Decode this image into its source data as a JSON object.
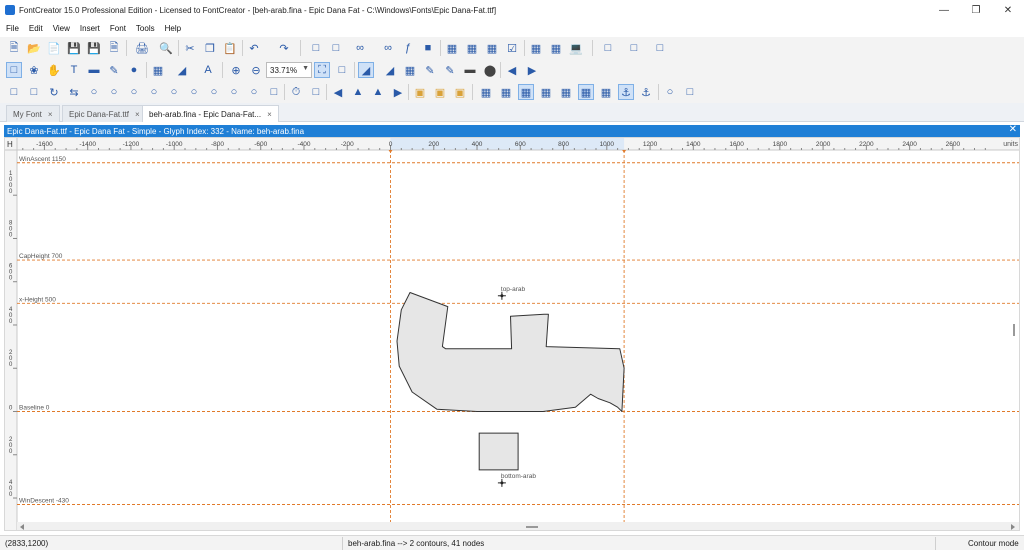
{
  "window": {
    "title": "FontCreator 15.0 Professional Edition - Licensed to FontCreator - [beh-arab.fina - Epic Dana Fat - C:\\Windows\\Fonts\\Epic Dana-Fat.ttf]",
    "minimize": "—",
    "maximize": "❐",
    "close": "✕"
  },
  "menu": [
    "File",
    "Edit",
    "View",
    "Insert",
    "Font",
    "Tools",
    "Help"
  ],
  "toolbar": {
    "zoom": "33.71%"
  },
  "tabs": [
    {
      "label": "My Font",
      "close": "×"
    },
    {
      "label": "Epic Dana-Fat.ttf",
      "close": "×"
    },
    {
      "label": "beh-arab.fina - Epic Dana-Fat...",
      "close": "×"
    }
  ],
  "document": {
    "title": "Epic Dana-Fat.ttf - Epic Dana Fat - Simple - Glyph Index: 332 - Name: beh-arab.fina",
    "close": "✕"
  },
  "ruler": {
    "corner": "H",
    "units": "units",
    "x_ticks": [
      -1600,
      -1400,
      -1200,
      -1000,
      -800,
      -600,
      -400,
      -200,
      0,
      200,
      400,
      600,
      800,
      1000,
      1200,
      1400,
      1600,
      1800,
      2000,
      2200,
      2400,
      2600
    ],
    "y_labels": [
      {
        "text": "1000",
        "value": 1000
      },
      {
        "text": "800",
        "value": 800
      },
      {
        "text": "600",
        "value": 600
      },
      {
        "text": "400",
        "value": 400
      },
      {
        "text": "200",
        "value": 200
      },
      {
        "text": "0",
        "value": 0
      },
      {
        "text": "200",
        "value": -200
      },
      {
        "text": "400",
        "value": -400
      }
    ]
  },
  "guidelines": [
    {
      "label": "WinAscent 1150",
      "value": 1150
    },
    {
      "label": "CapHeight 700",
      "value": 700
    },
    {
      "label": "x-Height 500",
      "value": 500
    },
    {
      "label": "Baseline 0",
      "value": 0
    },
    {
      "label": "WinDescent -430",
      "value": -430
    }
  ],
  "vertical_guides": [
    0,
    1080
  ],
  "anchors": [
    {
      "label": "top-arab",
      "x": 515,
      "y": 535
    },
    {
      "label": "bottom-arab",
      "x": 515,
      "y": -330
    }
  ],
  "glyph": {
    "outline": [
      [
        90,
        550
      ],
      [
        265,
        485
      ],
      [
        240,
        300
      ],
      [
        255,
        290
      ],
      [
        405,
        290
      ],
      [
        540,
        290
      ],
      [
        550,
        290
      ],
      [
        560,
        290
      ],
      [
        555,
        440
      ],
      [
        710,
        450
      ],
      [
        730,
        450
      ],
      [
        720,
        300
      ],
      [
        1060,
        290
      ],
      [
        1080,
        200
      ],
      [
        1075,
        100
      ],
      [
        1070,
        0
      ],
      [
        1050,
        20
      ],
      [
        1015,
        40
      ],
      [
        960,
        60
      ],
      [
        925,
        80
      ],
      [
        855,
        20
      ],
      [
        705,
        0
      ],
      [
        400,
        0
      ],
      [
        215,
        10
      ],
      [
        100,
        90
      ],
      [
        40,
        210
      ],
      [
        30,
        325
      ],
      [
        50,
        470
      ]
    ],
    "square": [
      [
        410,
        -100
      ],
      [
        590,
        -100
      ],
      [
        590,
        -270
      ],
      [
        410,
        -270
      ]
    ]
  },
  "status": {
    "coords": "(2833,1200)",
    "info": "beh-arab.fina -->   2 contours, 41 nodes",
    "mode": "Contour mode"
  },
  "colors": {
    "accent": "#1f7fd6",
    "guide": "#e07a2a",
    "glyph_fill": "#e6e6e6",
    "glyph_stroke": "#333333"
  }
}
